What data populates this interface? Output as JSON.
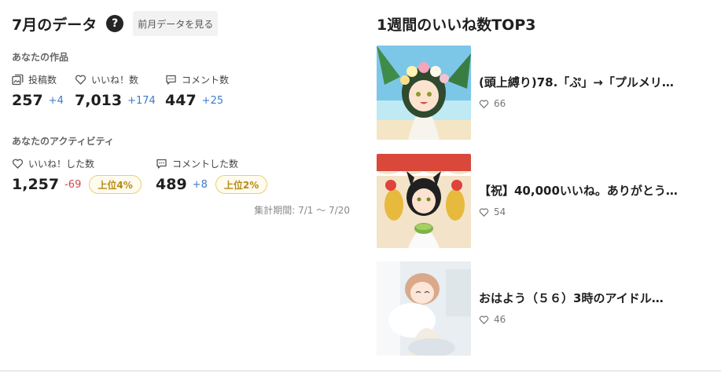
{
  "monthly": {
    "title": "7月のデータ",
    "help": "?",
    "prev_button": "前月データを見る",
    "works_label": "あなたの作品",
    "activity_label": "あなたのアクティビティ",
    "period": "集計期間: 7/1 〜 7/20",
    "works": [
      {
        "label": "投稿数",
        "icon": "posts-icon",
        "value": "257",
        "delta": "+4"
      },
      {
        "label": "いいね！数",
        "icon": "heart-icon",
        "value": "7,013",
        "delta": "+174"
      },
      {
        "label": "コメント数",
        "icon": "comment-icon",
        "value": "447",
        "delta": "+25"
      }
    ],
    "activity": [
      {
        "label": "いいね！した数",
        "icon": "heart-icon",
        "value": "1,257",
        "delta": "-69",
        "rank": "上位4%"
      },
      {
        "label": "コメントした数",
        "icon": "comment-icon",
        "value": "489",
        "delta": "+8",
        "rank": "上位2%"
      }
    ]
  },
  "weekly": {
    "title": "1週間のいいね数TOP3",
    "items": [
      {
        "title": "(頭上縛り)78.「ぷ」→「プルメリ…",
        "likes": "66"
      },
      {
        "title": "【祝】40,000いいね。ありがとう…",
        "likes": "54"
      },
      {
        "title": "おはよう（５６）3時のアイドル…",
        "likes": "46"
      }
    ]
  },
  "colors": {
    "delta_positive": "#3d7cc9",
    "delta_negative": "#d3484d",
    "rank_badge": "#b88a12"
  }
}
